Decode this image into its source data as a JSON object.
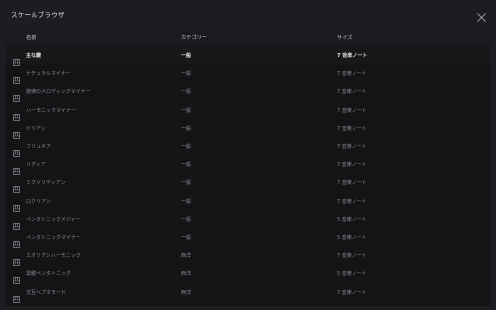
{
  "window": {
    "title": "スケールブラウザ"
  },
  "table": {
    "columns": {
      "name": "名前",
      "category": "カテゴリー",
      "size": "サイズ"
    },
    "rows": [
      {
        "name": "主な鍵",
        "category": "一般",
        "size": "7 音楽ノート"
      },
      {
        "name": "ナチュラルマイナー",
        "category": "一般",
        "size": "7 音楽ノート"
      },
      {
        "name": "旋律のメロディックマイナー",
        "category": "一般",
        "size": "7 音楽ノート"
      },
      {
        "name": "ハーモニックマイナー",
        "category": "一般",
        "size": "7 音楽ノート"
      },
      {
        "name": "ドリアン",
        "category": "一般",
        "size": "7 音楽ノート"
      },
      {
        "name": "フリュギア",
        "category": "一般",
        "size": "7 音楽ノート"
      },
      {
        "name": "リディア",
        "category": "一般",
        "size": "7 音楽ノート"
      },
      {
        "name": "ミクソリディアン",
        "category": "一般",
        "size": "7 音楽ノート"
      },
      {
        "name": "ロクリアン",
        "category": "一般",
        "size": "7 音楽ノート"
      },
      {
        "name": "ペンタトニックメジャー",
        "category": "一般",
        "size": "5 音楽ノート"
      },
      {
        "name": "ペンタトニックマイナー",
        "category": "一般",
        "size": "5 音楽ノート"
      },
      {
        "name": "エオリアンハーモニック",
        "category": "西洋",
        "size": "7 音楽ノート"
      },
      {
        "name": "黒鍵ペンタトニック",
        "category": "西洋",
        "size": "5 音楽ノート"
      },
      {
        "name": "交互ヘプタモード",
        "category": "西洋",
        "size": "7 音楽ノート"
      }
    ]
  },
  "icons": {
    "close": "close-icon",
    "row": "piano-keys-icon"
  },
  "colors": {
    "background": "#1d1d21",
    "panel": "#141417",
    "selected_text": "#e4e4e7",
    "muted_text": "#8a8a91"
  }
}
